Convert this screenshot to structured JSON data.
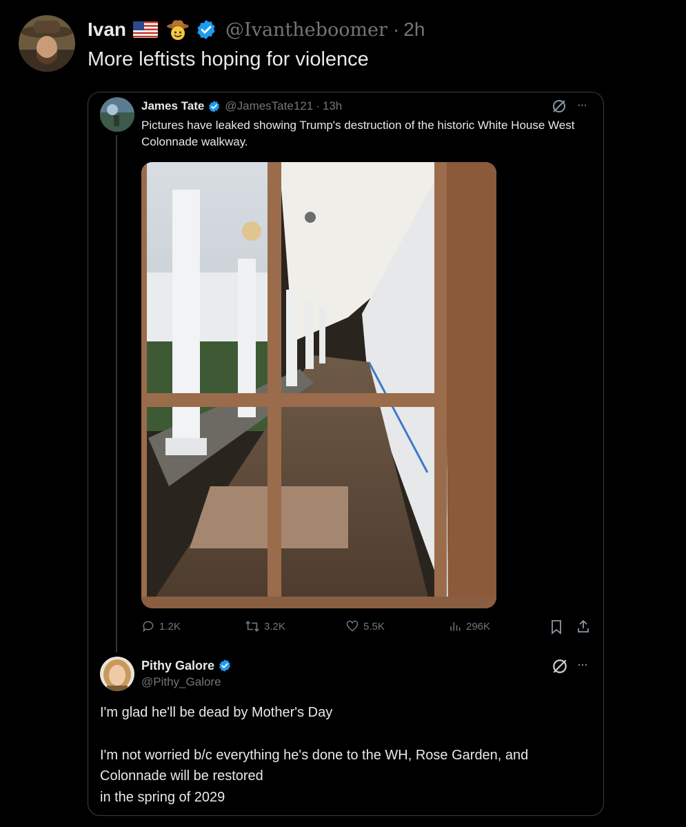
{
  "main_tweet": {
    "author_name": "Ivan",
    "flag_emoji": "🇺🇸",
    "hat_emoji": "🤠",
    "handle": "@Ivantheboomer",
    "separator": "·",
    "time": "2h",
    "text": "More leftists hoping for violence",
    "avatar_icon": "cowboy-portrait"
  },
  "quoted_tweet": {
    "author_name": "James Tate",
    "handle": "@JamesTate121",
    "separator": "·",
    "time": "13h",
    "text": "Pictures have leaked showing Trump's destruction of the historic White House West Colonnade walkway.",
    "more_label": "···",
    "stats": {
      "replies": "1.2K",
      "reposts": "3.2K",
      "likes": "5.5K",
      "views": "296K"
    }
  },
  "reply_tweet": {
    "author_name": "Pithy Galore",
    "handle": "@Pithy_Galore",
    "more_label": "···",
    "line1": "I'm glad he'll be dead by Mother's Day",
    "line2": "I'm not worried b/c everything he's done to the WH, Rose Garden, and",
    "line3": "Colonnade will be restored",
    "line4": "in the spring of 2029"
  },
  "colors": {
    "background": "#000000",
    "text": "#e7e9ea",
    "muted": "#71767b",
    "verified": "#1d9bf0",
    "border": "#3a3f44"
  }
}
